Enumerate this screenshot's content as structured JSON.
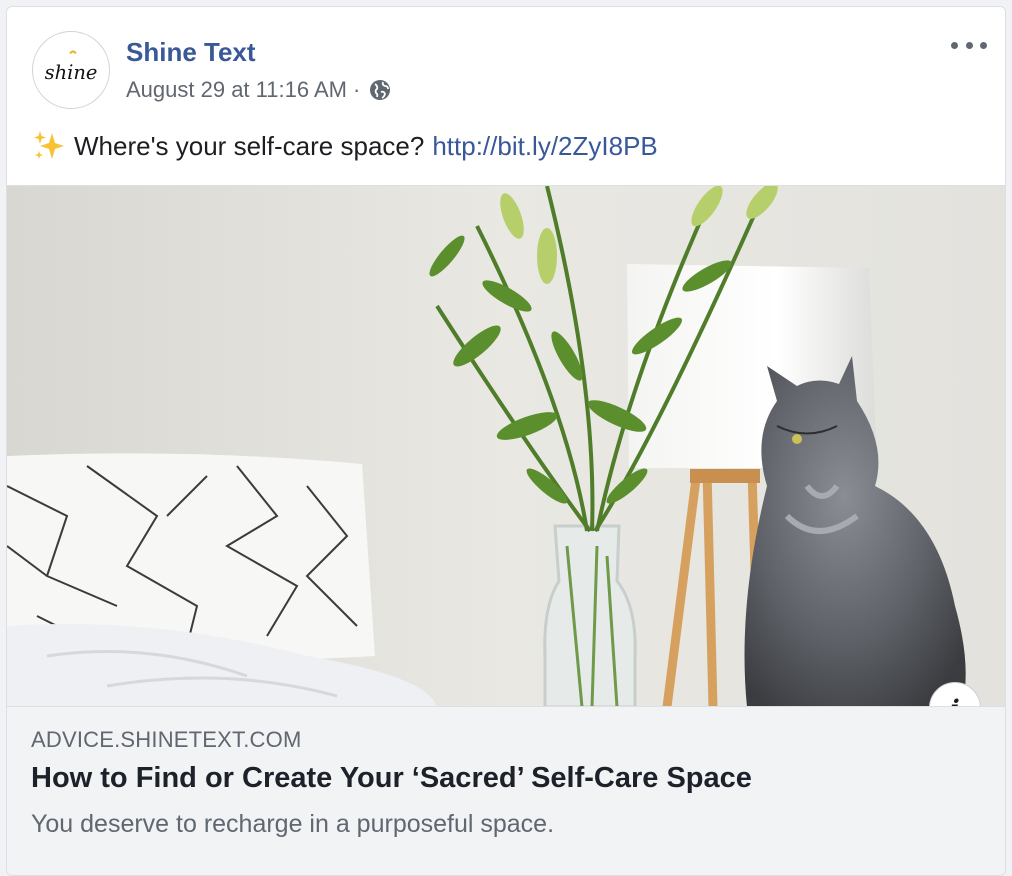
{
  "post": {
    "page_name": "Shine Text",
    "timestamp": "August 29 at 11:16 AM",
    "separator": "·",
    "privacy_icon": "globe-icon",
    "more_icon": "more-options-icon",
    "avatar_text": "shine",
    "text": "Where's your self-care space?",
    "emoji": "sparkles-icon",
    "link": "http://bit.ly/2ZyI8PB"
  },
  "link_preview": {
    "domain": "ADVICE.SHINETEXT.COM",
    "title": "How to Find or Create Your ‘Sacred’ Self-Care Space",
    "description": "You deserve to recharge in a purposeful space.",
    "info_label": "i"
  },
  "colors": {
    "link_blue": "#385898",
    "meta_gray": "#606770",
    "preview_bg": "#f2f3f5"
  }
}
